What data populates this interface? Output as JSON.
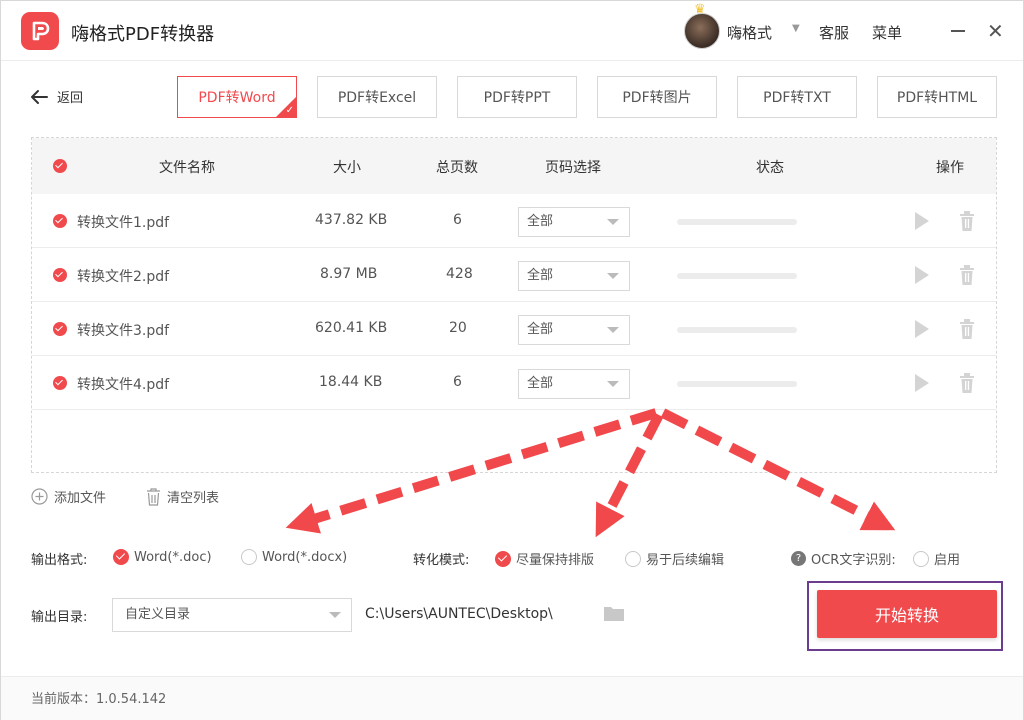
{
  "app": {
    "title": "嗨格式PDF转换器"
  },
  "header": {
    "username": "嗨格式",
    "service": "客服",
    "menu": "菜单"
  },
  "back_label": "返回",
  "tabs": [
    {
      "label": "PDF转Word",
      "active": true
    },
    {
      "label": "PDF转Excel",
      "active": false
    },
    {
      "label": "PDF转PPT",
      "active": false
    },
    {
      "label": "PDF转图片",
      "active": false
    },
    {
      "label": "PDF转TXT",
      "active": false
    },
    {
      "label": "PDF转HTML",
      "active": false
    }
  ],
  "table": {
    "headers": {
      "name": "文件名称",
      "size": "大小",
      "pages": "总页数",
      "page_select": "页码选择",
      "status": "状态",
      "actions": "操作"
    },
    "rows": [
      {
        "name": "转换文件1.pdf",
        "size": "437.82 KB",
        "pages": "6",
        "page_select": "全部",
        "progress": 0
      },
      {
        "name": "转换文件2.pdf",
        "size": "8.97 MB",
        "pages": "428",
        "page_select": "全部",
        "progress": 0
      },
      {
        "name": "转换文件3.pdf",
        "size": "620.41 KB",
        "pages": "20",
        "page_select": "全部",
        "progress": 0
      },
      {
        "name": "转换文件4.pdf",
        "size": "18.44 KB",
        "pages": "6",
        "page_select": "全部",
        "progress": 0
      }
    ]
  },
  "actions": {
    "add_file": "添加文件",
    "clear_list": "清空列表"
  },
  "options": {
    "format_label": "输出格式:",
    "format_doc": "Word(*.doc)",
    "format_docx": "Word(*.docx)",
    "mode_label": "转化模式:",
    "mode_keep": "尽量保持排版",
    "mode_edit": "易于后续编辑",
    "ocr_label": "OCR文字识别:",
    "ocr_enable": "启用"
  },
  "output": {
    "dir_label": "输出目录:",
    "dir_select": "自定义目录",
    "path": "C:\\Users\\AUNTEC\\Desktop\\",
    "start_button": "开始转换"
  },
  "footer": {
    "version": "当前版本：1.0.54.142"
  },
  "colors": {
    "accent": "#f04a4d",
    "highlight_outline": "#6a3d8f"
  }
}
